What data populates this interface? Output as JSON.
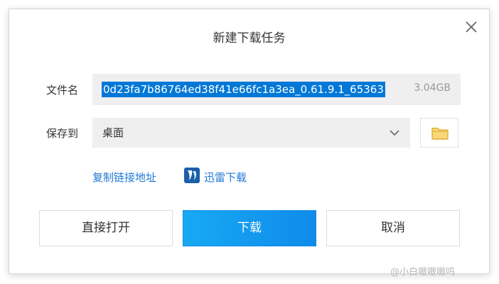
{
  "dialog": {
    "title": "新建下载任务",
    "close_icon": "close-icon"
  },
  "filename": {
    "label": "文件名",
    "value": "0d23fa7b86764ed38f41e66fc1a3ea_0.61.9.1_65363",
    "size": "3.04GB",
    "selection_color": "#0078d7"
  },
  "save_to": {
    "label": "保存到",
    "value": "桌面",
    "dropdown_icon": "chevron-down-icon",
    "folder_icon": "folder-icon"
  },
  "links": {
    "copy_link": "复制链接地址",
    "xunlei": "迅雷下载",
    "link_color": "#1e78d6"
  },
  "buttons": {
    "open_direct": "直接打开",
    "download": "下载",
    "cancel": "取消"
  },
  "colors": {
    "primary": "#0f8bea",
    "field_bg": "#efefef",
    "folder": "#f4c24b"
  },
  "watermark": "@小白嗷嗷嗷呜"
}
